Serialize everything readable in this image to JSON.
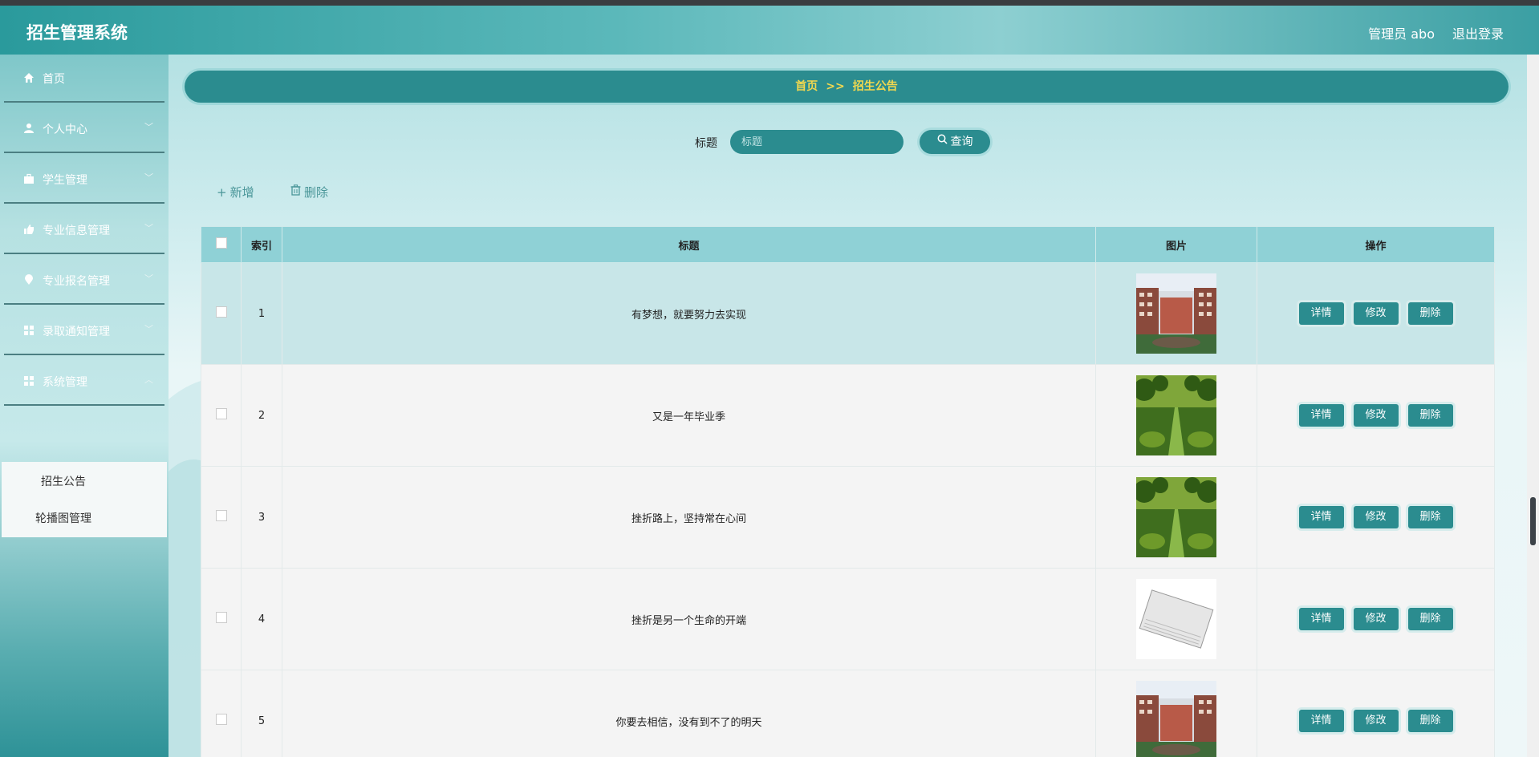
{
  "header": {
    "app_title": "招生管理系统",
    "admin_label": "管理员 abo",
    "logout_label": "退出登录"
  },
  "sidebar": {
    "items": [
      {
        "label": "首页",
        "icon": "home-icon"
      },
      {
        "label": "个人中心",
        "icon": "user-icon"
      },
      {
        "label": "学生管理",
        "icon": "briefcase-icon"
      },
      {
        "label": "专业信息管理",
        "icon": "thumbs-up-icon"
      },
      {
        "label": "专业报名管理",
        "icon": "location-pin-icon"
      },
      {
        "label": "录取通知管理",
        "icon": "grid-icon"
      },
      {
        "label": "系统管理",
        "icon": "grid-icon"
      }
    ],
    "submenu": [
      {
        "label": "招生公告"
      },
      {
        "label": "轮播图管理"
      }
    ]
  },
  "breadcrumb": {
    "home": "首页",
    "separator": ">>",
    "current": "招生公告"
  },
  "search": {
    "label": "标题",
    "placeholder": "标题",
    "button_label": "查询"
  },
  "actions": {
    "add_label": "新增",
    "delete_label": "删除"
  },
  "table": {
    "headers": {
      "index": "索引",
      "title": "标题",
      "image": "图片",
      "operation": "操作"
    },
    "op_labels": {
      "detail": "详情",
      "edit": "修改",
      "delete": "删除"
    },
    "rows": [
      {
        "index": "1",
        "title": "有梦想，就要努力去实现",
        "image": "campus-building-photo"
      },
      {
        "index": "2",
        "title": "又是一年毕业季",
        "image": "green-tree-path-photo"
      },
      {
        "index": "3",
        "title": "挫折路上，坚持常在心间",
        "image": "green-tree-path-photo"
      },
      {
        "index": "4",
        "title": "挫折是另一个生命的开端",
        "image": "news-newspaper-image"
      },
      {
        "index": "5",
        "title": "你要去相信，没有到不了的明天",
        "image": "campus-building-photo"
      }
    ]
  },
  "colors": {
    "accent": "#2b8c8f",
    "breadcrumb_text": "#f2d84f",
    "table_header": "#8fd1d6"
  }
}
